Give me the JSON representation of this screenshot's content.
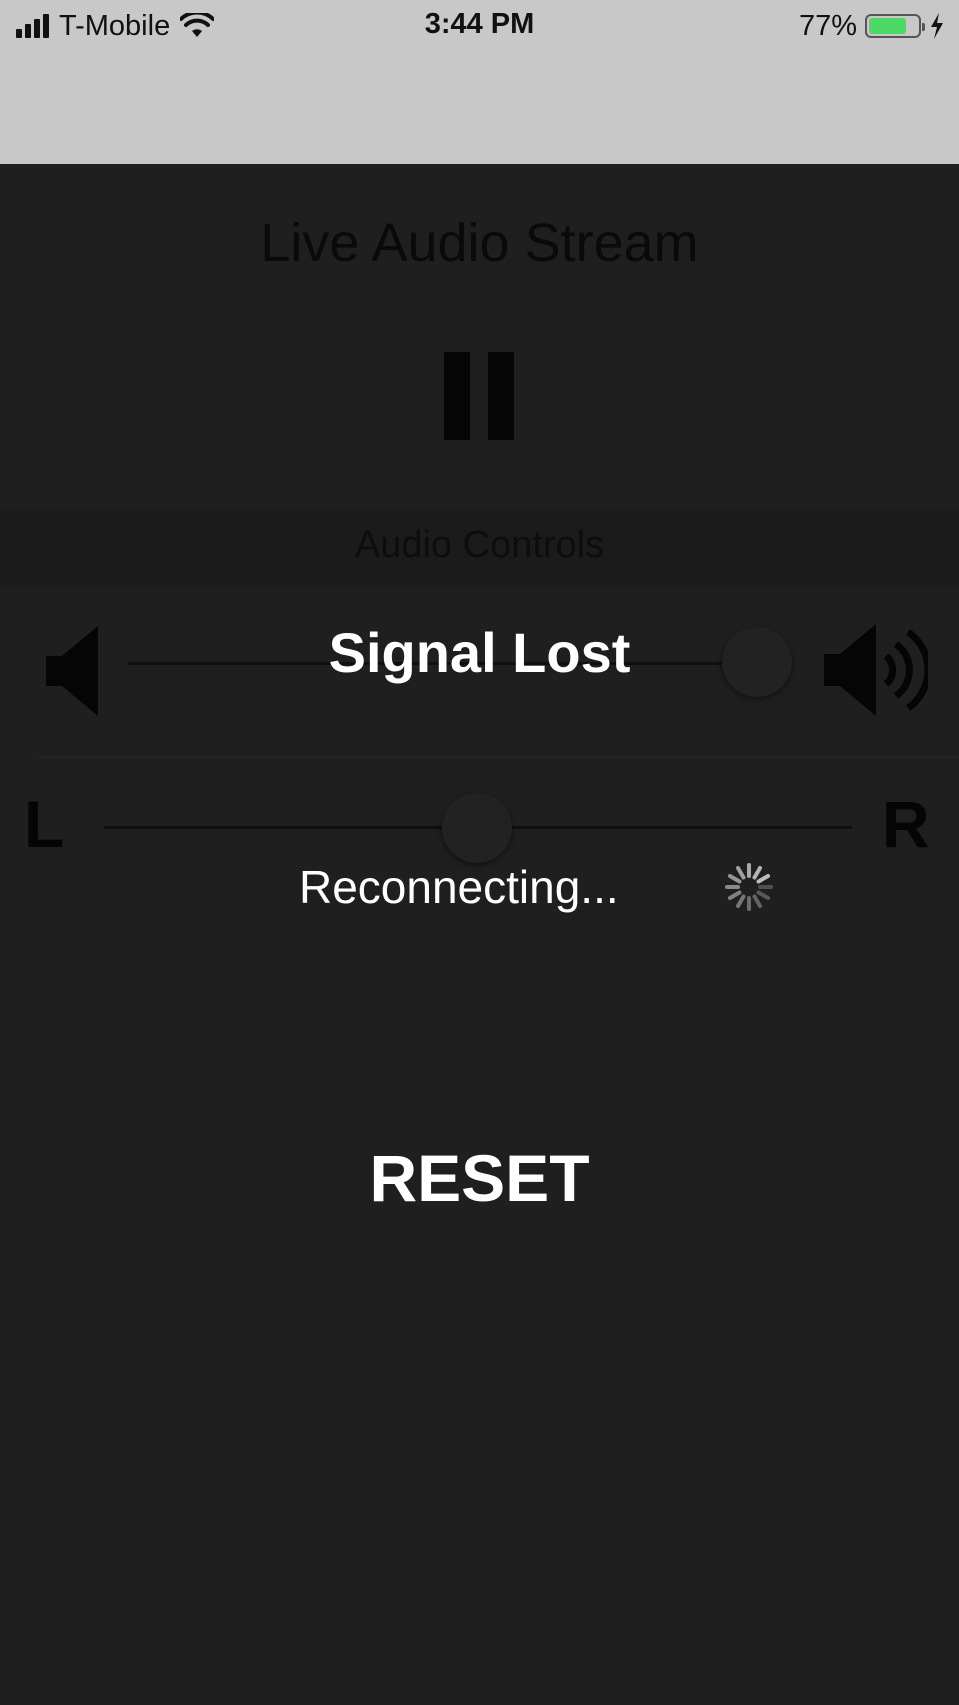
{
  "status_bar": {
    "carrier": "T-Mobile",
    "time": "3:44 PM",
    "battery_percent_label": "77%",
    "battery_level": 0.77,
    "charging": true,
    "signal_icon": "cellular-signal-icon",
    "wifi_icon": "wifi-icon",
    "charging_icon": "lightning-bolt-icon"
  },
  "app": {
    "title": "Live Audio Stream",
    "playback_state": "playing",
    "pause_icon": "pause-icon",
    "controls_header": "Audio Controls",
    "volume": {
      "low_icon": "speaker-low-icon",
      "high_icon": "speaker-high-icon",
      "level": 0.93
    },
    "balance": {
      "left_label": "L",
      "right_label": "R",
      "level": 0.5
    }
  },
  "overlay": {
    "title": "Signal Lost",
    "status": "Reconnecting...",
    "spinner_icon": "activity-spinner-icon",
    "reset_label": "RESET"
  },
  "colors": {
    "background": "#1f1f1f",
    "status_bar": "#c8c8c8",
    "overlay_text": "#ffffff",
    "battery_fill": "#4cd964"
  }
}
